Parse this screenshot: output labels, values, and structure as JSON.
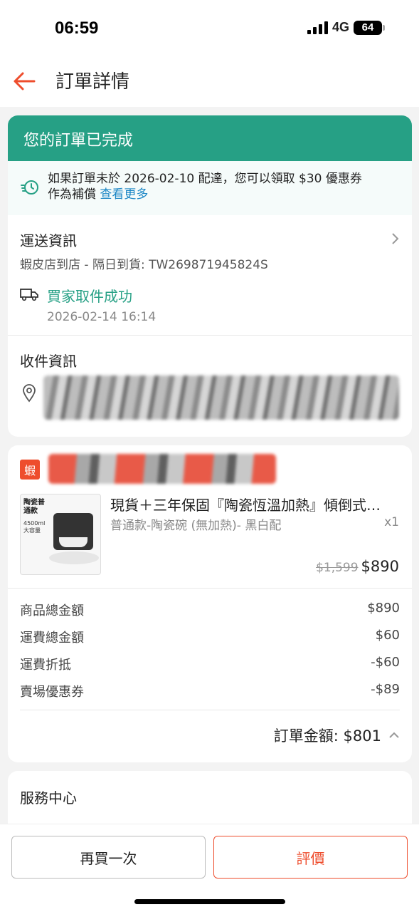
{
  "status_bar": {
    "time": "06:59",
    "network": "4G",
    "battery": "64"
  },
  "nav": {
    "title": "訂單詳情"
  },
  "order_status": {
    "banner": "您的訂單已完成",
    "notice_line1": "如果訂單未於 2026-02-10 配達，您可以領取 $30 優惠券",
    "notice_line2": "作為補償",
    "notice_link": "查看更多"
  },
  "shipping": {
    "title": "運送資訊",
    "detail": "蝦皮店到店 - 隔日到貨: TW269871945824S",
    "status": "買家取件成功",
    "status_time": "2026-02-14 16:14"
  },
  "recipient": {
    "title": "收件資訊"
  },
  "shop": {
    "badge": "蝦"
  },
  "product": {
    "name": "現貨＋三年保固『陶瓷恆溫加熱』傾倒式…",
    "variant": "普通款-陶瓷碗 (無加熱)- 黑白配",
    "qty": "x1",
    "original_price": "$1,599",
    "price": "$890",
    "image_label": "陶瓷普通款",
    "image_capacity": "4500ml大容量"
  },
  "summary": {
    "rows": [
      {
        "label": "商品總金額",
        "value": "$890"
      },
      {
        "label": "運費總金額",
        "value": "$60"
      },
      {
        "label": "運費折抵",
        "value": "-$60"
      },
      {
        "label": "賣場優惠券",
        "value": "-$89"
      }
    ],
    "total_label": "訂單金額: $801"
  },
  "service": {
    "title": "服務中心"
  },
  "actions": {
    "rebuy": "再買一次",
    "review": "評價"
  },
  "colors": {
    "accent_green": "#26a085",
    "brand_orange": "#ee4d2d",
    "link_blue": "#1b86c5"
  }
}
